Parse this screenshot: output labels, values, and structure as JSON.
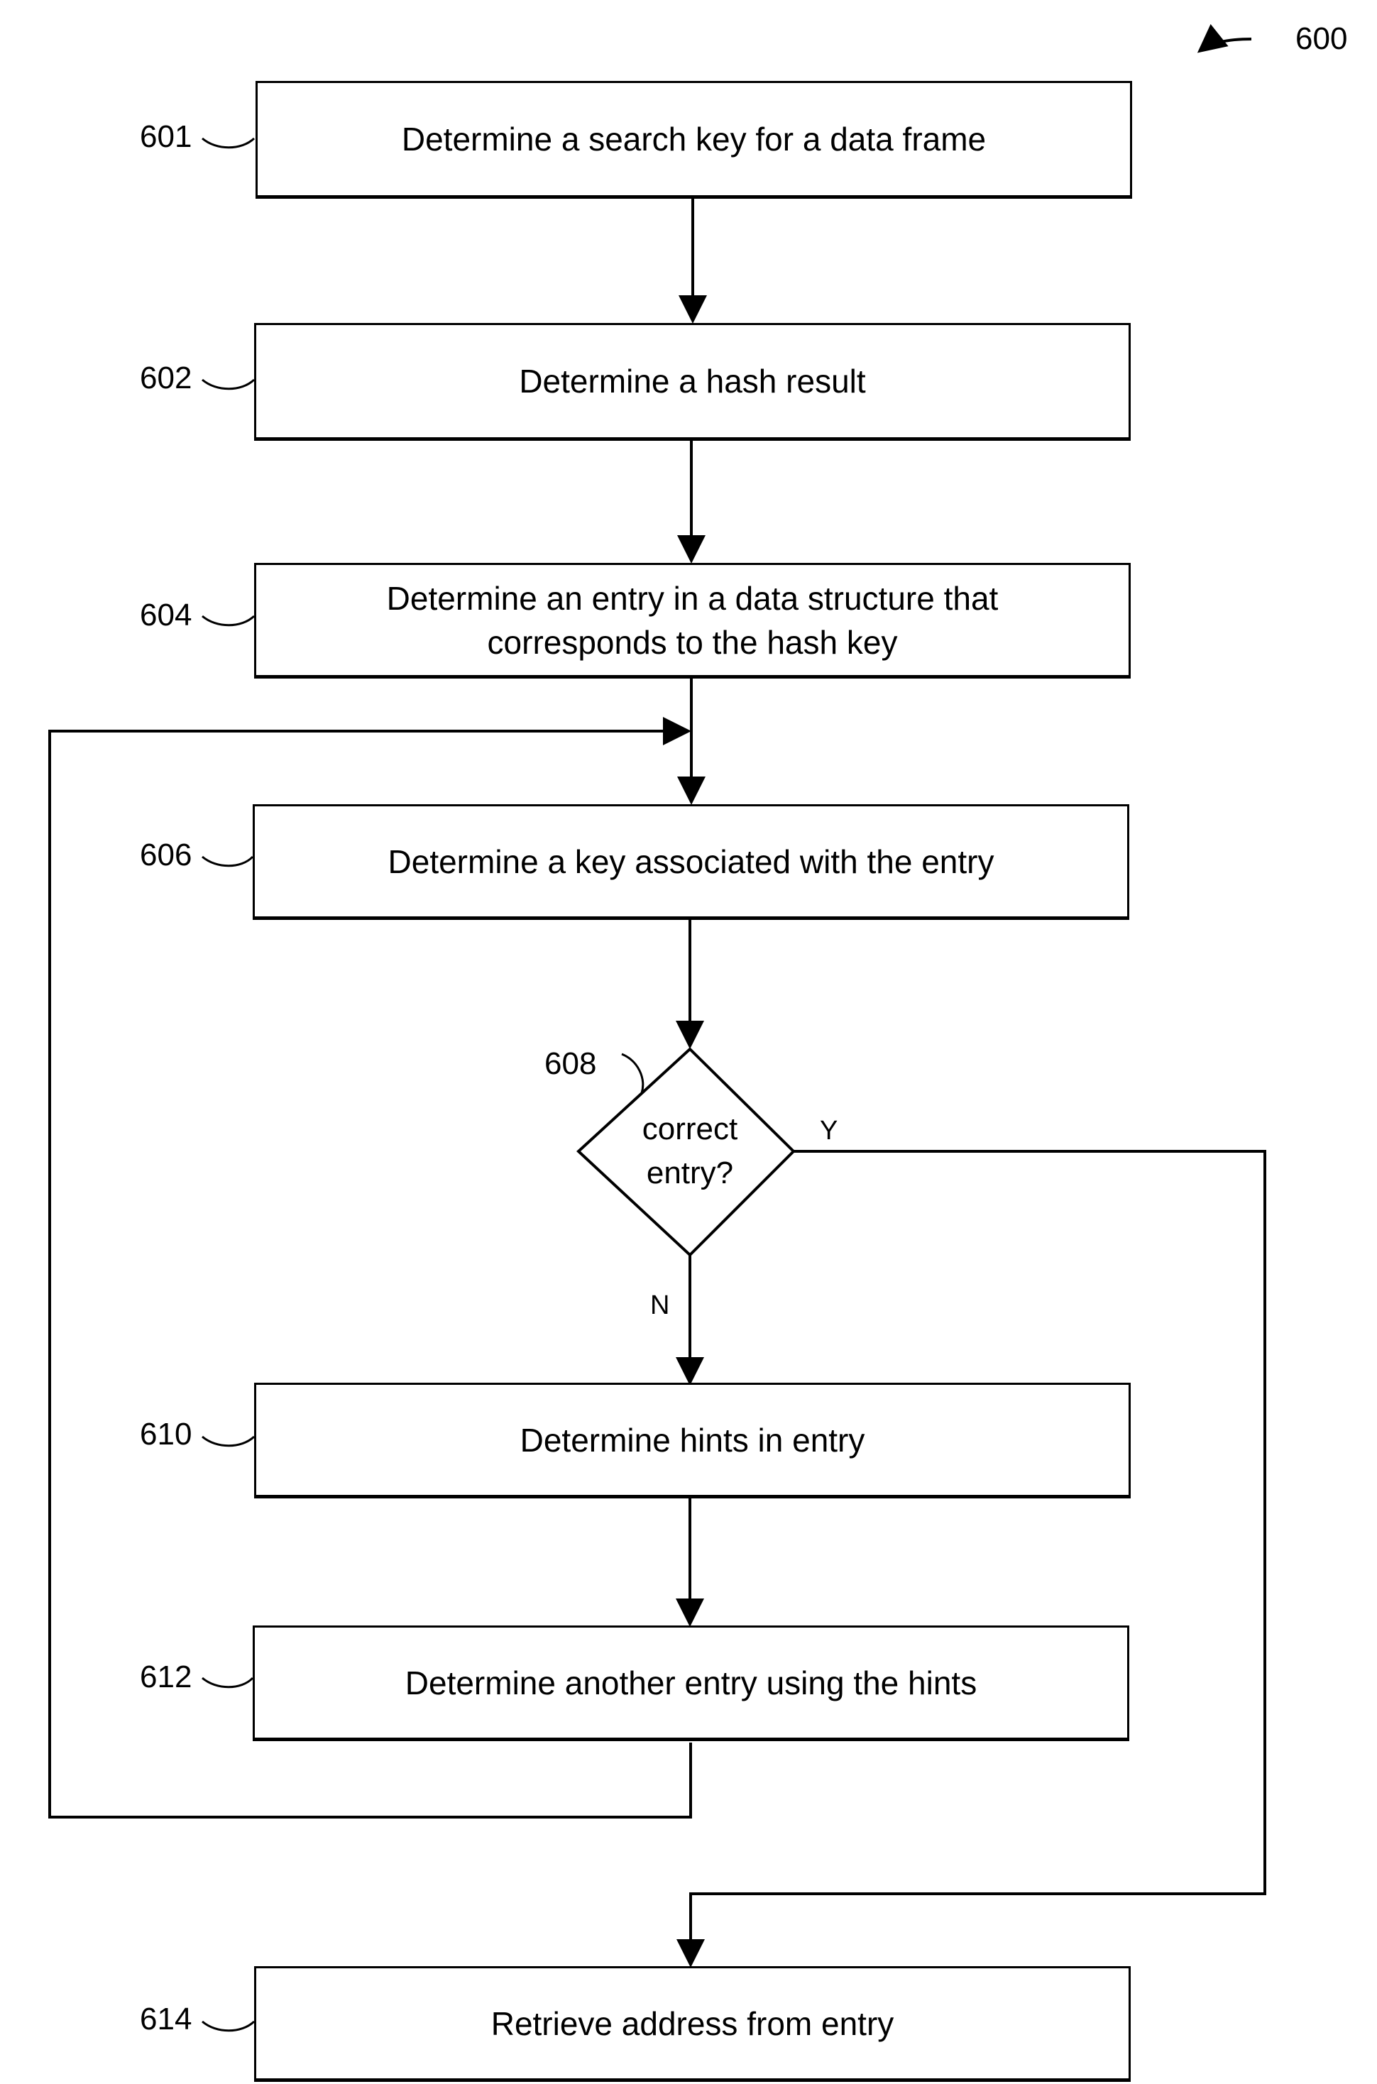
{
  "figure": {
    "number": "600",
    "steps": [
      {
        "id": "601",
        "text": "Determine a search key for a data frame"
      },
      {
        "id": "602",
        "text": "Determine a hash result"
      },
      {
        "id": "604",
        "text": "Determine an entry in a data structure that corresponds to the hash key"
      },
      {
        "id": "606",
        "text": "Determine a key associated with the entry"
      },
      {
        "id": "610",
        "text": "Determine hints in entry"
      },
      {
        "id": "612",
        "text": "Determine another entry using the hints"
      },
      {
        "id": "614",
        "text": "Retrieve address from entry"
      }
    ],
    "decision": {
      "id": "608",
      "text": "correct entry?",
      "yes_label": "Y",
      "no_label": "N"
    }
  }
}
